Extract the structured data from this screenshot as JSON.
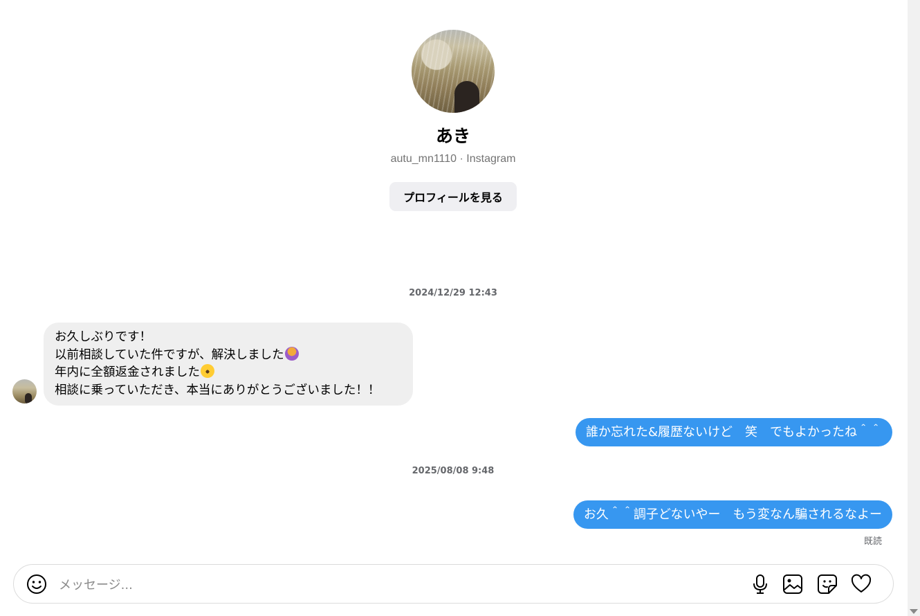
{
  "profile": {
    "name": "あき",
    "subtitle": "autu_mn1110 · Instagram",
    "view_profile_label": "プロフィールを見る"
  },
  "messages": [
    {
      "type": "timestamp",
      "text": "2024/12/29 12:43"
    },
    {
      "type": "incoming",
      "lines": [
        "お久しぶりです！",
        "以前相談していた件ですが、解決しました",
        "年内に全額返金されました",
        "相談に乗っていただき、本当にありがとうございました！！"
      ],
      "emojis": [
        "person-gesturing-icon",
        "crying-face-icon"
      ]
    },
    {
      "type": "outgoing",
      "text": "誰か忘れた&履歴ないけど　笑　でもよかったね＾＾"
    },
    {
      "type": "timestamp",
      "text": "2025/08/08 9:48"
    },
    {
      "type": "outgoing",
      "text": "お久＾＾調子どないやー　もう変なん騙されるなよー"
    }
  ],
  "read_receipt": "既読",
  "composer": {
    "placeholder": "メッセージ...",
    "icons": [
      "emoji-icon",
      "microphone-icon",
      "image-icon",
      "sticker-icon",
      "heart-icon"
    ]
  },
  "colors": {
    "outgoing_bubble": "#3797f0",
    "incoming_bubble": "#efefef",
    "profile_button_bg": "#efeff2"
  }
}
